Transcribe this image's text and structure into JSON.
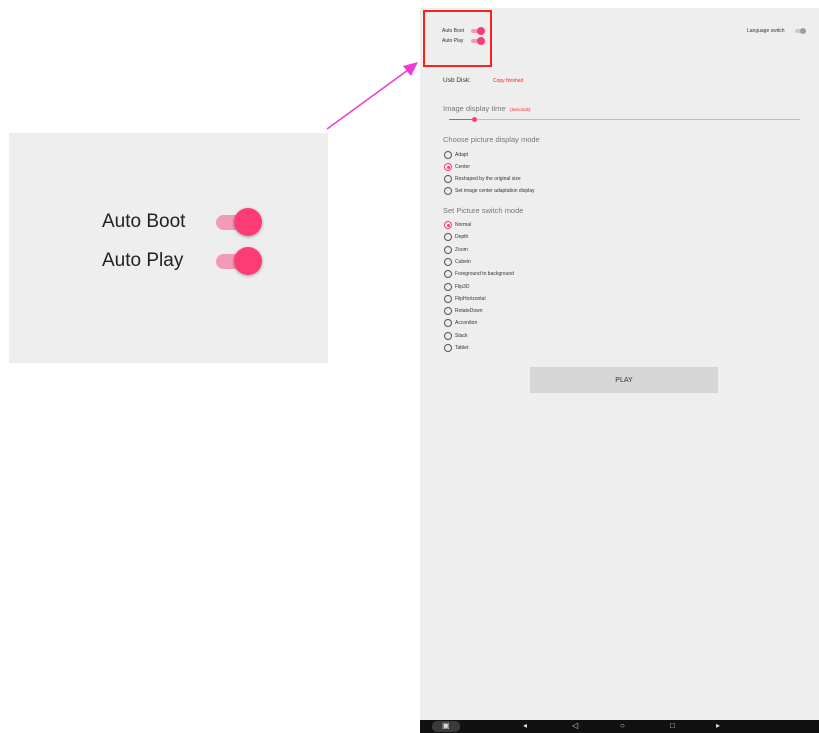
{
  "zoom": {
    "auto_boot_label": "Auto Boot",
    "auto_play_label": "Auto Play"
  },
  "header": {
    "auto_boot_label": "Auto Boot",
    "auto_play_label": "Auto Play",
    "language_switch_label": "Language switch"
  },
  "usb": {
    "label": "Usb Disk:",
    "status": "Copy finished"
  },
  "display_time": {
    "label": "Image display time",
    "unit": "(Seconds)"
  },
  "display_mode": {
    "heading": "Choose picture display mode",
    "options": [
      {
        "label": "Adapt",
        "selected": false
      },
      {
        "label": "Center",
        "selected": true
      },
      {
        "label": "Reshaped by the original size",
        "selected": false
      },
      {
        "label": "Set image center adaptation display",
        "selected": false
      }
    ]
  },
  "switch_mode": {
    "heading": "Set Picture switch mode",
    "options": [
      {
        "label": "Normal",
        "selected": true
      },
      {
        "label": "Depth",
        "selected": false
      },
      {
        "label": "Zoom",
        "selected": false
      },
      {
        "label": "Cubein",
        "selected": false
      },
      {
        "label": "Foreground to background",
        "selected": false
      },
      {
        "label": "Flip3D",
        "selected": false
      },
      {
        "label": "FlipHorizontal",
        "selected": false
      },
      {
        "label": "RotateDown",
        "selected": false
      },
      {
        "label": "Accordion",
        "selected": false
      },
      {
        "label": "Stack",
        "selected": false
      },
      {
        "label": "Tablet",
        "selected": false
      }
    ]
  },
  "play_button_label": "PLAY",
  "colors": {
    "accent": "#fd3c76",
    "accent_light": "#f39ab7",
    "status_red": "#ff1f1f",
    "arrow": "#ee3ad6"
  },
  "navbar": {
    "icons": [
      "camera-icon",
      "volume-down-icon",
      "back-icon",
      "home-icon",
      "recents-icon",
      "volume-up-icon"
    ]
  }
}
